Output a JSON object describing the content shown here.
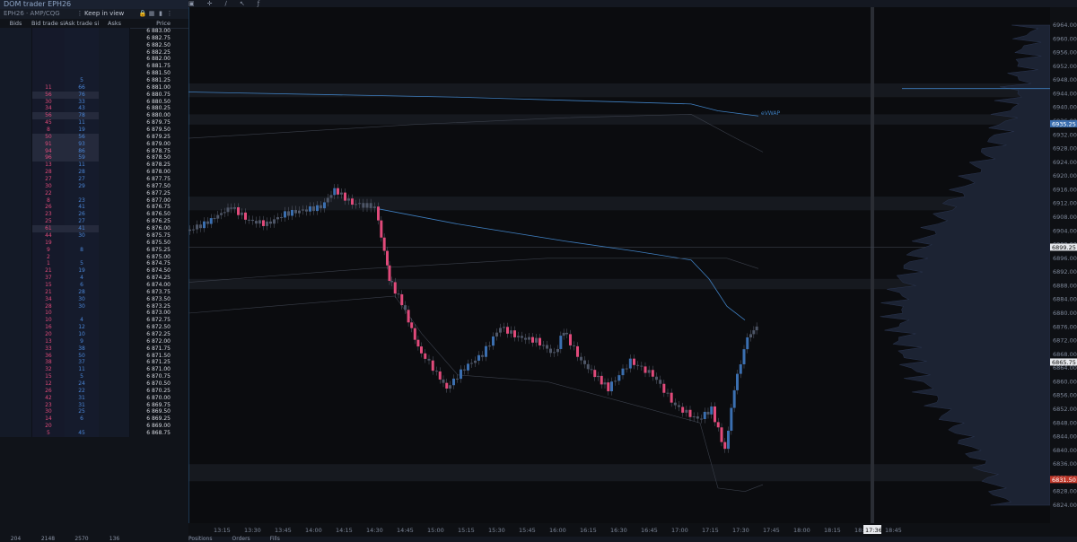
{
  "dom": {
    "title": "DOM trader EPH26",
    "symbol": "EPH26 · AMP/CQG",
    "keep_in_view": "Keep in view",
    "headers": {
      "bids": "Bids",
      "bid_trade_size": "Bid trade si...",
      "ask_trade_size": "Ask trade size",
      "asks": "Asks",
      "price": "Price"
    },
    "rows": [
      {
        "price": "6 883.00",
        "bt": "",
        "at": ""
      },
      {
        "price": "6 882.75",
        "bt": "",
        "at": ""
      },
      {
        "price": "6 882.50",
        "bt": "",
        "at": ""
      },
      {
        "price": "6 882.25",
        "bt": "",
        "at": ""
      },
      {
        "price": "6 882.00",
        "bt": "",
        "at": ""
      },
      {
        "price": "6 881.75",
        "bt": "",
        "at": ""
      },
      {
        "price": "6 881.50",
        "bt": "",
        "at": ""
      },
      {
        "price": "6 881.25",
        "bt": "",
        "at": "5"
      },
      {
        "price": "6 881.00",
        "bt": "11",
        "at": "66"
      },
      {
        "price": "6 880.75",
        "bt": "56",
        "at": "76"
      },
      {
        "price": "6 880.50",
        "bt": "30",
        "at": "33"
      },
      {
        "price": "6 880.25",
        "bt": "34",
        "at": "43"
      },
      {
        "price": "6 880.00",
        "bt": "56",
        "at": "78"
      },
      {
        "price": "6 879.75",
        "bt": "45",
        "at": "11"
      },
      {
        "price": "6 879.50",
        "bt": "8",
        "at": "19"
      },
      {
        "price": "6 879.25",
        "bt": "50",
        "at": "56"
      },
      {
        "price": "6 879.00",
        "bt": "91",
        "at": "93"
      },
      {
        "price": "6 878.75",
        "bt": "94",
        "at": "86"
      },
      {
        "price": "6 878.50",
        "bt": "96",
        "at": "59"
      },
      {
        "price": "6 878.25",
        "bt": "13",
        "at": "11"
      },
      {
        "price": "6 878.00",
        "bt": "28",
        "at": "28"
      },
      {
        "price": "6 877.75",
        "bt": "27",
        "at": "27"
      },
      {
        "price": "6 877.50",
        "bt": "30",
        "at": "29"
      },
      {
        "price": "6 877.25",
        "bt": "22",
        "at": ""
      },
      {
        "price": "6 877.00",
        "bt": "8",
        "at": "23"
      },
      {
        "price": "6 876.75",
        "bt": "26",
        "at": "41"
      },
      {
        "price": "6 876.50",
        "bt": "23",
        "at": "26"
      },
      {
        "price": "6 876.25",
        "bt": "25",
        "at": "27"
      },
      {
        "price": "6 876.00",
        "bt": "61",
        "at": "41"
      },
      {
        "price": "6 875.75",
        "bt": "44",
        "at": "30"
      },
      {
        "price": "6 875.50",
        "bt": "19",
        "at": ""
      },
      {
        "price": "6 875.25",
        "bt": "9",
        "at": "8"
      },
      {
        "price": "6 875.00",
        "bt": "2",
        "at": ""
      },
      {
        "price": "6 874.75",
        "bt": "1",
        "at": "5"
      },
      {
        "price": "6 874.50",
        "bt": "21",
        "at": "19"
      },
      {
        "price": "6 874.25",
        "bt": "37",
        "at": "4"
      },
      {
        "price": "6 874.00",
        "bt": "15",
        "at": "6"
      },
      {
        "price": "6 873.75",
        "bt": "21",
        "at": "28"
      },
      {
        "price": "6 873.50",
        "bt": "34",
        "at": "30"
      },
      {
        "price": "6 873.25",
        "bt": "28",
        "at": "30"
      },
      {
        "price": "6 873.00",
        "bt": "10",
        "at": ""
      },
      {
        "price": "6 872.75",
        "bt": "10",
        "at": "4"
      },
      {
        "price": "6 872.50",
        "bt": "16",
        "at": "12"
      },
      {
        "price": "6 872.25",
        "bt": "20",
        "at": "10"
      },
      {
        "price": "6 872.00",
        "bt": "13",
        "at": "9"
      },
      {
        "price": "6 871.75",
        "bt": "33",
        "at": "38"
      },
      {
        "price": "6 871.50",
        "bt": "36",
        "at": "50"
      },
      {
        "price": "6 871.25",
        "bt": "38",
        "at": "37"
      },
      {
        "price": "6 871.00",
        "bt": "32",
        "at": "11"
      },
      {
        "price": "6 870.75",
        "bt": "15",
        "at": "5"
      },
      {
        "price": "6 870.50",
        "bt": "12",
        "at": "24"
      },
      {
        "price": "6 870.25",
        "bt": "26",
        "at": "22"
      },
      {
        "price": "6 870.00",
        "bt": "42",
        "at": "31"
      },
      {
        "price": "6 869.75",
        "bt": "23",
        "at": "31"
      },
      {
        "price": "6 869.50",
        "bt": "30",
        "at": "25"
      },
      {
        "price": "6 869.25",
        "bt": "14",
        "at": "6"
      },
      {
        "price": "6 869.00",
        "bt": "20",
        "at": ""
      },
      {
        "price": "6 868.75",
        "bt": "5",
        "at": "45"
      }
    ],
    "footer": {
      "bids": "204",
      "bid_trade": "2148",
      "ask_trade": "2570",
      "asks": "136"
    }
  },
  "chart": {
    "time_labels": [
      "13:15",
      "13:30",
      "13:45",
      "14:00",
      "14:15",
      "14:30",
      "14:45",
      "15:00",
      "15:15",
      "15:30",
      "15:45",
      "16:00",
      "16:15",
      "16:30",
      "16:45",
      "17:00",
      "17:15",
      "17:30",
      "17:45",
      "18:00",
      "18:15",
      "18:30",
      "18:45"
    ],
    "time_cursor": "17:36",
    "price_labels": [
      "6964.00",
      "6960.00",
      "6956.00",
      "6952.00",
      "6948.00",
      "6944.00",
      "6940.00",
      "6936.00",
      "6932.00",
      "6928.00",
      "6924.00",
      "6920.00",
      "6916.00",
      "6912.00",
      "6908.00",
      "6904.00",
      "6900.00",
      "6896.00",
      "6892.00",
      "6888.00",
      "6884.00",
      "6880.00",
      "6876.00",
      "6872.00",
      "6868.00",
      "6864.00",
      "6860.00",
      "6856.00",
      "6852.00",
      "6848.00",
      "6844.00",
      "6840.00",
      "6836.00",
      "6832.00",
      "6828.00",
      "6824.00"
    ],
    "price_markers": {
      "upper": "6935.25",
      "mid": "6899.25",
      "current": "6865.75",
      "low": "6831.50"
    },
    "vwap_label": "eVWAP",
    "bottom_tabs": [
      "Positions",
      "Orders",
      "Fills"
    ]
  },
  "colors": {
    "bid": "#e04a7a",
    "ask": "#4a86d8",
    "vwap": "#3f7fc0"
  }
}
